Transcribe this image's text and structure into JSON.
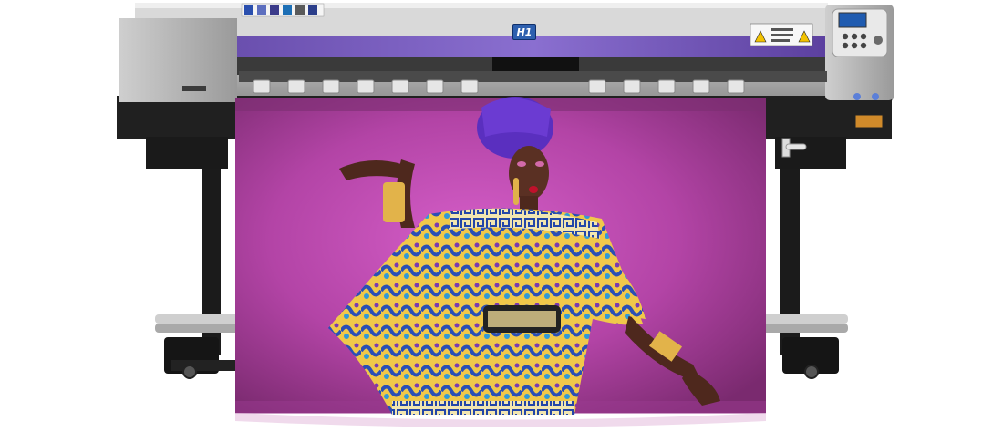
{
  "product": {
    "brand_badge": "H1",
    "type": "large-format eco-solvent printer"
  },
  "control_panel": {
    "has_lcd": true,
    "button_count": 6
  },
  "colors": {
    "body_gray": "#b9b9b9",
    "accent_purple": "#6b4fb0",
    "frame_black": "#1a1a1a",
    "banner_magenta": "#c04bb6",
    "badge_blue": "#2d5fae"
  },
  "icons": [
    "printer-icon",
    "control-panel-icon",
    "warning-label-icon",
    "caster-wheel-icon",
    "media-roller-icon"
  ],
  "banner": {
    "subject": "printed banner",
    "background_color": "#b54aa8"
  }
}
